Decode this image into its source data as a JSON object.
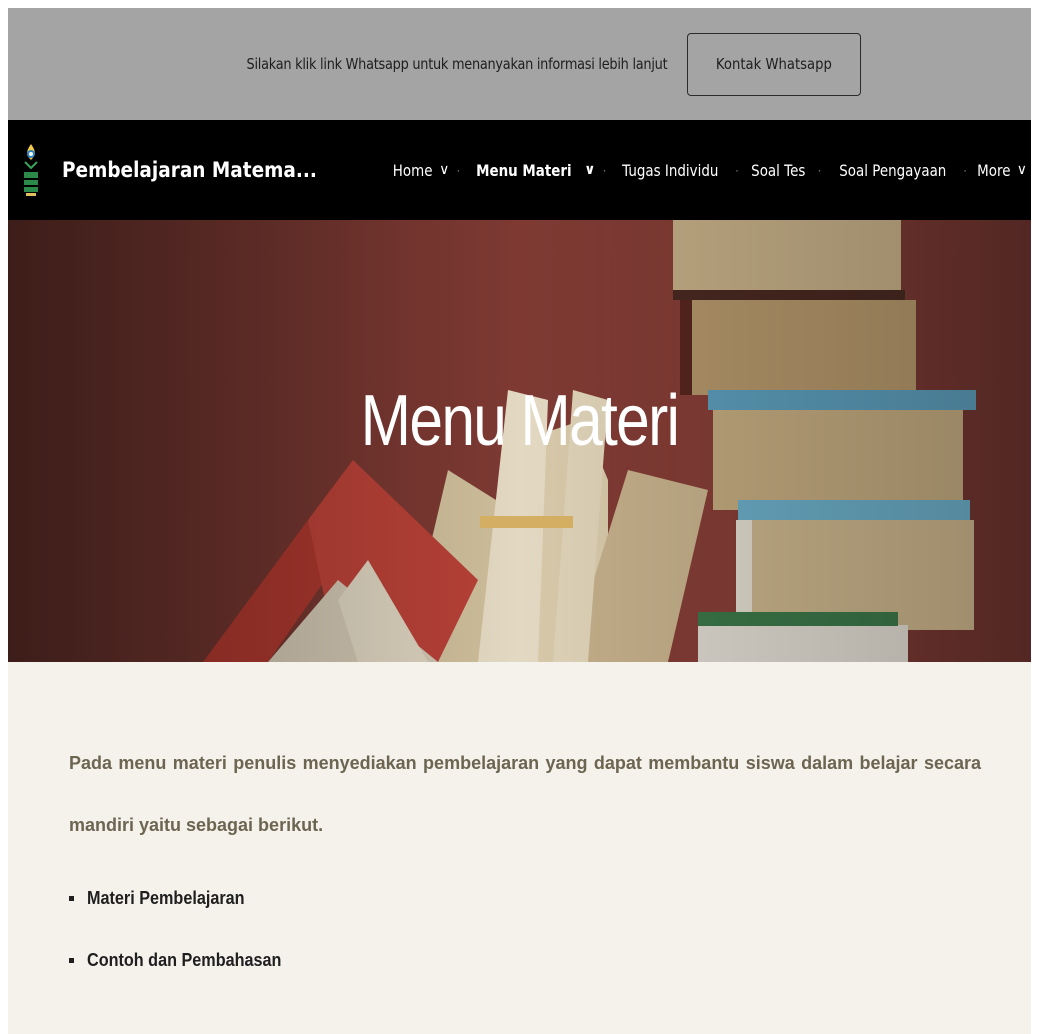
{
  "announcement": {
    "text": "Silakan klik link Whatsapp untuk menanyakan informasi lebih lanjut",
    "button_label": "Kontak Whatsapp"
  },
  "header": {
    "site_title": "Pembelajaran Matema...",
    "logo_icon": "uin-logo-icon",
    "nav": [
      {
        "label": "Home",
        "has_dropdown": true
      },
      {
        "label": "Menu Materi",
        "has_dropdown": true,
        "active": true
      },
      {
        "label": "Tugas Individu",
        "has_dropdown": false
      },
      {
        "label": "Soal Tes",
        "has_dropdown": false
      },
      {
        "label": "Soal Pengayaan",
        "has_dropdown": false
      },
      {
        "label": "More",
        "has_dropdown": true
      }
    ],
    "chevron_glyph": "∨",
    "separator_glyph": "·"
  },
  "hero": {
    "title": "Menu Materi",
    "accent_color": "#d4ae62"
  },
  "content": {
    "intro": "Pada menu materi penulis menyediakan pembelajaran yang dapat membantu siswa dalam belajar secara mandiri yaitu sebagai berikut.",
    "items": [
      "Materi Pembelajaran",
      "Contoh dan Pembahasan"
    ],
    "intro_color": "#6c6551"
  }
}
